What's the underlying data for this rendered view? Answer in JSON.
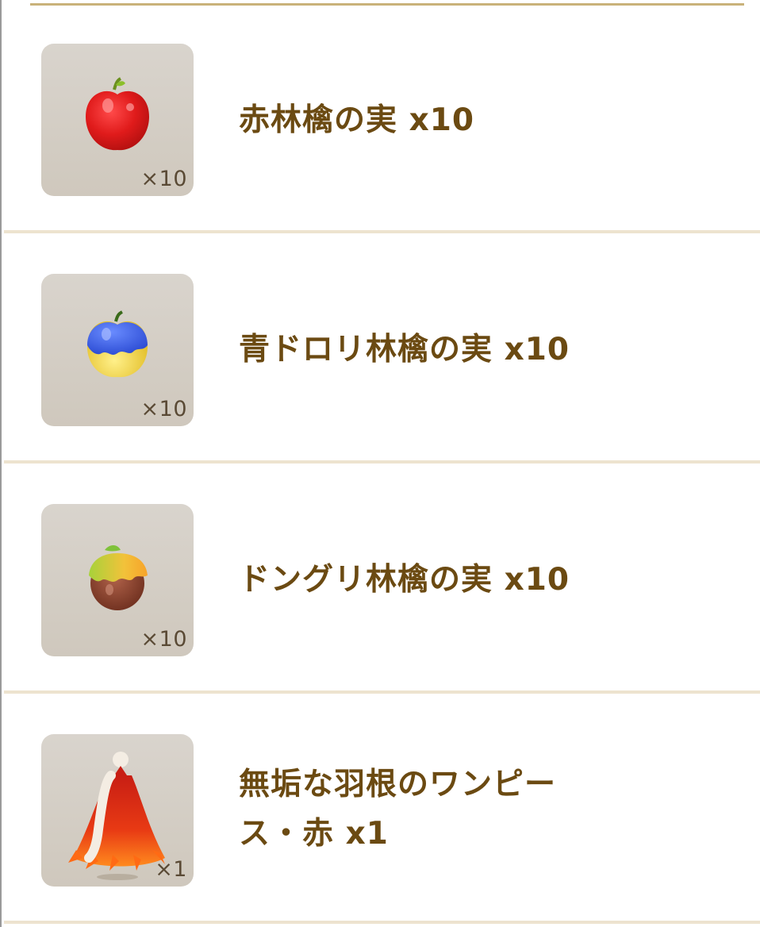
{
  "rewards": [
    {
      "name": "赤林檎の実 x10",
      "qty": "×10",
      "icon": "red-apple-icon"
    },
    {
      "name": "青ドロリ林檎の実 x10",
      "qty": "×10",
      "icon": "blue-drip-apple-icon"
    },
    {
      "name": "ドングリ林檎の実 x10",
      "qty": "×10",
      "icon": "acorn-apple-icon"
    },
    {
      "name": "無垢な羽根のワンピース・赤 x1",
      "qty": "×1",
      "icon": "red-feather-dress-icon"
    }
  ],
  "colors": {
    "text": "#6b4a12",
    "divider": "#ede3cf",
    "top_rule": "#c9b27a",
    "tile": "#d5cfc6"
  }
}
